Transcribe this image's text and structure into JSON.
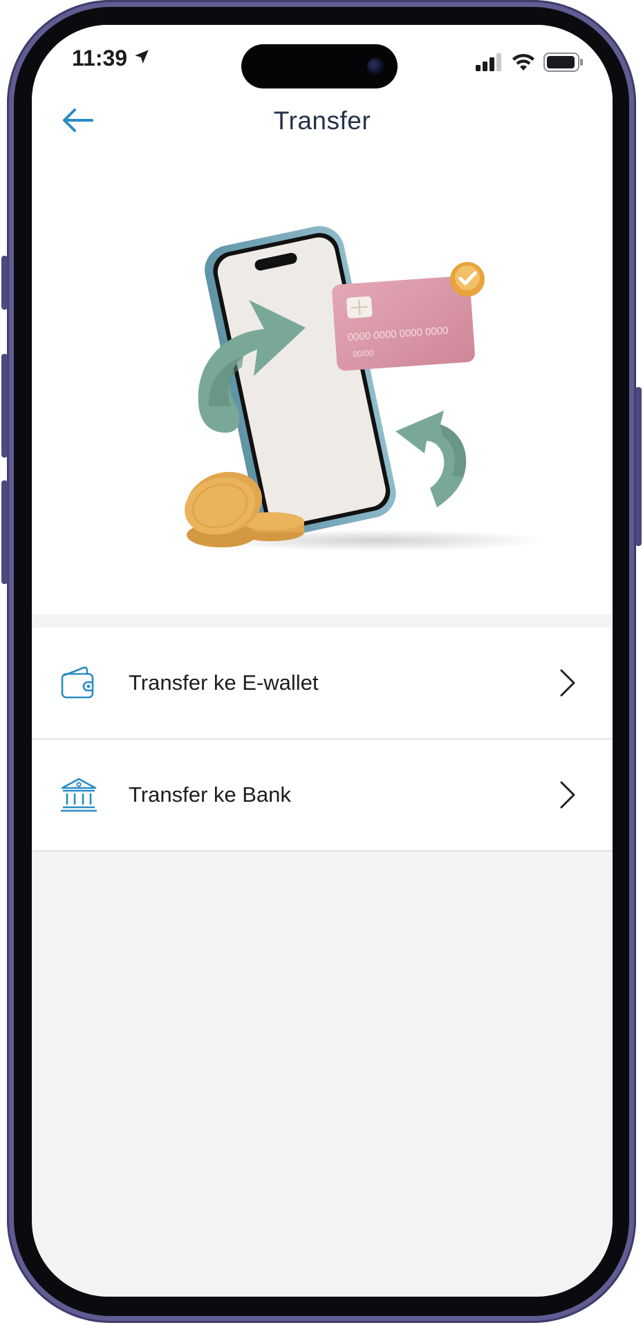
{
  "status_bar": {
    "time": "11:39",
    "location_icon": "location-arrow-icon",
    "signal_icon": "cellular-signal-icon",
    "wifi_icon": "wifi-icon",
    "battery_icon": "battery-icon"
  },
  "header": {
    "title": "Transfer",
    "back_icon": "arrow-left-icon"
  },
  "illustration": {
    "card_number": "0000 0000 0000 0000",
    "card_expiry": "00/00"
  },
  "menu": {
    "items": [
      {
        "label": "Transfer ke E-wallet",
        "icon": "wallet-icon"
      },
      {
        "label": "Transfer ke Bank",
        "icon": "bank-icon"
      }
    ]
  },
  "colors": {
    "accent": "#2a8bc4",
    "title_text": "#26314a",
    "item_text": "#1c1c22",
    "page_background": "#f3f3f3",
    "card_pink": "#d9909f",
    "arrow_green": "#7aa898",
    "coin_gold": "#ebb45c",
    "check_badge": "#e8a33a"
  }
}
